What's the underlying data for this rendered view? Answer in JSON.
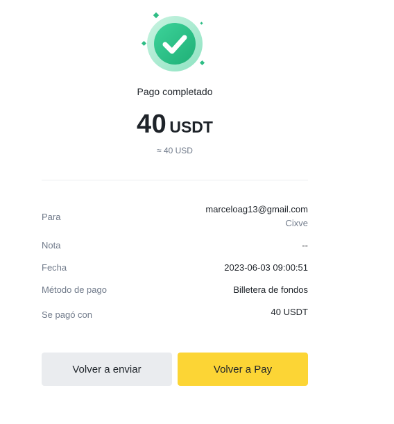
{
  "status": {
    "title": "Pago completado",
    "amount": "40",
    "currency": "USDT",
    "approx": "≈ 40 USD",
    "icon": "check-circle-icon",
    "accent_color": "#2EBD85"
  },
  "details": {
    "para": {
      "label": "Para",
      "email": "marceloag13@gmail.com",
      "name": "Cixve"
    },
    "nota": {
      "label": "Nota",
      "value": "--"
    },
    "fecha": {
      "label": "Fecha",
      "value": "2023-06-03 09:00:51"
    },
    "metodo": {
      "label": "Método de pago",
      "value": "Billetera de fondos"
    },
    "pago_con": {
      "label": "Se pagó con",
      "value": "40 USDT"
    }
  },
  "actions": {
    "resend_label": "Volver a enviar",
    "back_to_pay_label": "Volver a Pay"
  }
}
